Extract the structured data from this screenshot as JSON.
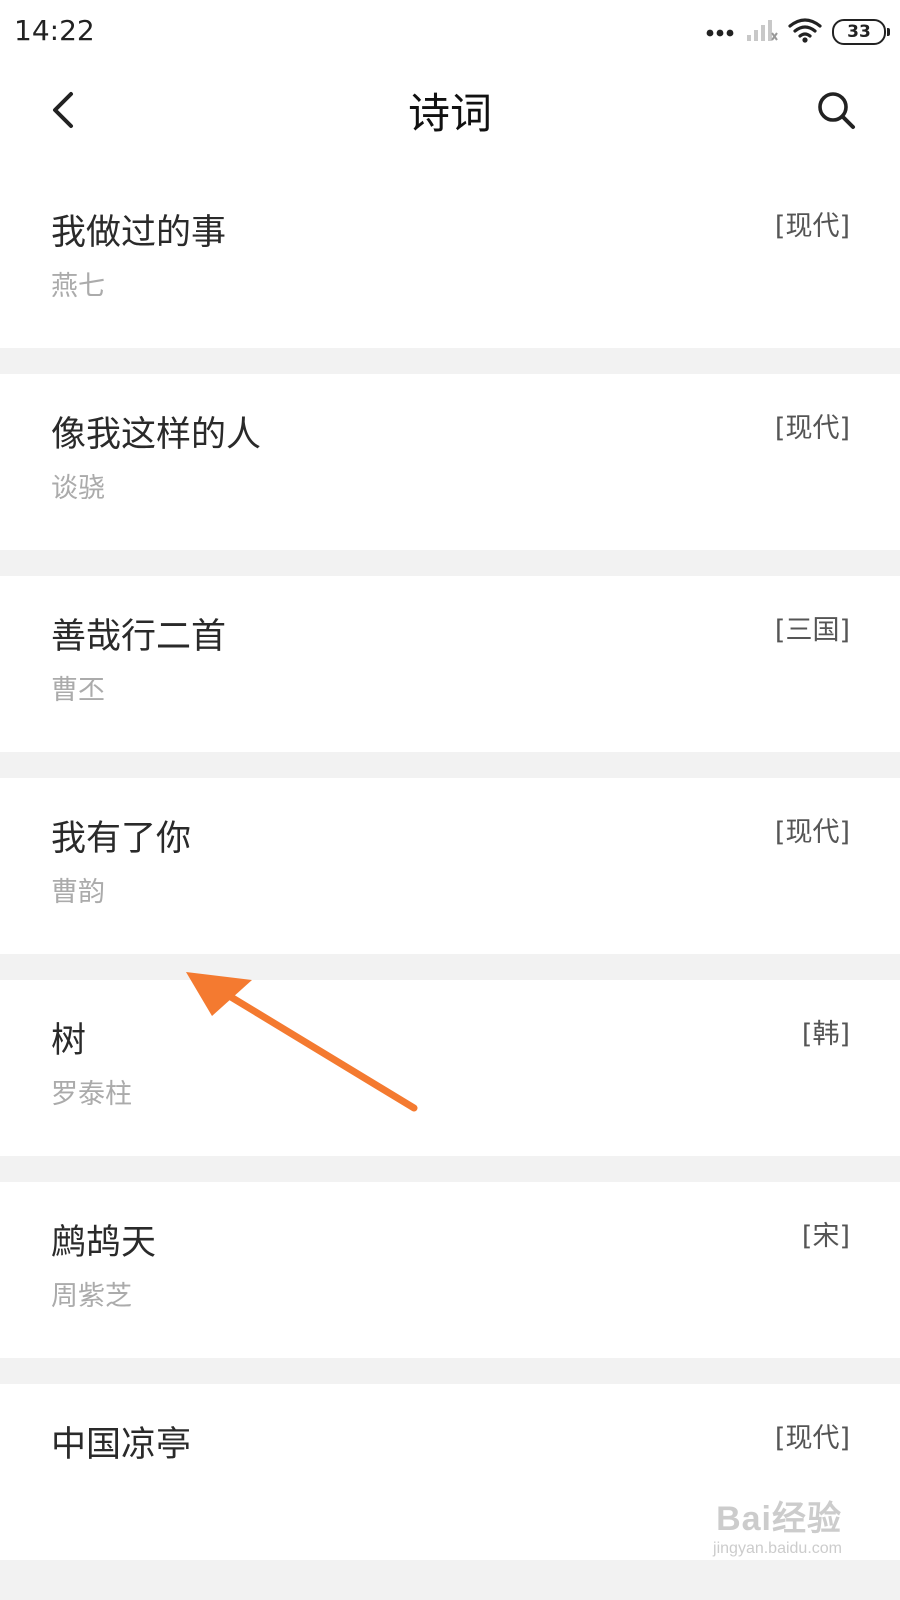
{
  "status_bar": {
    "time": "14:22",
    "battery": "33"
  },
  "header": {
    "title": "诗词",
    "back_icon": "chevron-left-icon",
    "search_icon": "search-icon"
  },
  "poems": [
    {
      "title": "我做过的事",
      "author": "燕七",
      "era": "[现代]"
    },
    {
      "title": "像我这样的人",
      "author": "谈骁",
      "era": "[现代]"
    },
    {
      "title": "善哉行二首",
      "author": "曹丕",
      "era": "[三国]"
    },
    {
      "title": "我有了你",
      "author": "曹韵",
      "era": "[现代]"
    },
    {
      "title": "树",
      "author": "罗泰柱",
      "era": "[韩]"
    },
    {
      "title": "鹧鸪天",
      "author": "周紫芝",
      "era": "[宋]"
    },
    {
      "title": "中国凉亭",
      "author": "",
      "era": "[现代]"
    }
  ],
  "annotation": {
    "arrow_color": "#f47a30"
  },
  "watermark": {
    "brand": "Bai经验",
    "url": "jingyan.baidu.com"
  }
}
